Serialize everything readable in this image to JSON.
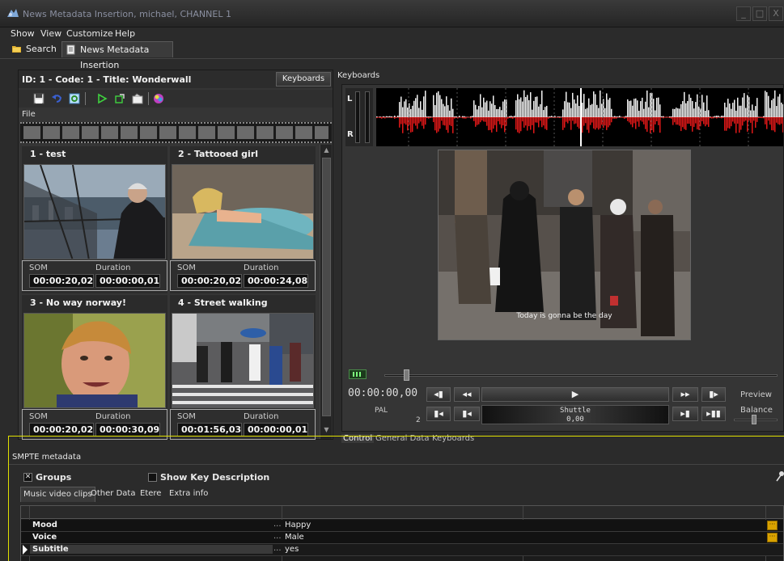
{
  "window": {
    "title": "News Metadata Insertion, michael, CHANNEL 1",
    "controls": [
      "_",
      "□",
      "X"
    ]
  },
  "menu": [
    "Show",
    "View",
    "Customize",
    "Help"
  ],
  "tool_tabs": [
    {
      "label": "Search",
      "icon": "search-folder-icon"
    },
    {
      "label": "News Metadata Insertion",
      "icon": "document-icon"
    }
  ],
  "left_panel": {
    "title": "ID: 1 - Code: 1 - Title: Wonderwall",
    "keyboards_button": "Keyboards",
    "file_label": "File",
    "toolbar_icons": [
      "save-icon",
      "undo-icon",
      "refresh-icon",
      "play-icon",
      "export-icon",
      "capture-icon",
      "color-icon"
    ],
    "clips": [
      {
        "title": "1 -  test",
        "som_label": "SOM",
        "duration_label": "Duration",
        "som": "00:00:20,02",
        "duration": "00:00:00,01"
      },
      {
        "title": "2 -  Tattooed girl",
        "som_label": "SOM",
        "duration_label": "Duration",
        "som": "00:00:20,02",
        "duration": "00:00:24,08"
      },
      {
        "title": "3 -  No way norway!",
        "som_label": "SOM",
        "duration_label": "Duration",
        "som": "00:00:20,02",
        "duration": "00:00:30,09"
      },
      {
        "title": "4 -  Street walking",
        "som_label": "SOM",
        "duration_label": "Duration",
        "som": "00:01:56,03",
        "duration": "00:00:00,01"
      }
    ]
  },
  "right_panel": {
    "label": "Keyboards",
    "meter_labels": [
      "L",
      "R"
    ],
    "subtitle": "Today is gonna be the day",
    "timeline_position": 0.05,
    "timecode": "00:00:00,00",
    "pal_label": "PAL",
    "pal_number": "2",
    "shuttle_label": "Shuttle",
    "shuttle_value": "0,00",
    "preview_label": "Preview",
    "balance_label": "Balance",
    "transport_top": [
      "◂▮",
      "◂◂",
      "▶",
      "▸▸",
      "▮▸"
    ],
    "transport_bottom": [
      "▮◂",
      "▮◂",
      "▸▮",
      "▸▮▮"
    ],
    "bottom_tabs": [
      "Control",
      "General Data",
      "Keyboards"
    ]
  },
  "smpte": {
    "title": "SMPTE metadata",
    "groups_label": "Groups",
    "groups_checked": true,
    "show_key_label": "Show Key Description",
    "show_key_checked": false,
    "tabs": [
      "Music video clips",
      "Other Data",
      "Etere",
      "Extra info"
    ],
    "rows": [
      {
        "key": "Mood",
        "value": "Happy",
        "has_button": true
      },
      {
        "key": "Voice",
        "value": "Male",
        "has_button": true
      },
      {
        "key": "Subtitle",
        "value": "yes",
        "has_button": false,
        "selected": true
      }
    ]
  }
}
